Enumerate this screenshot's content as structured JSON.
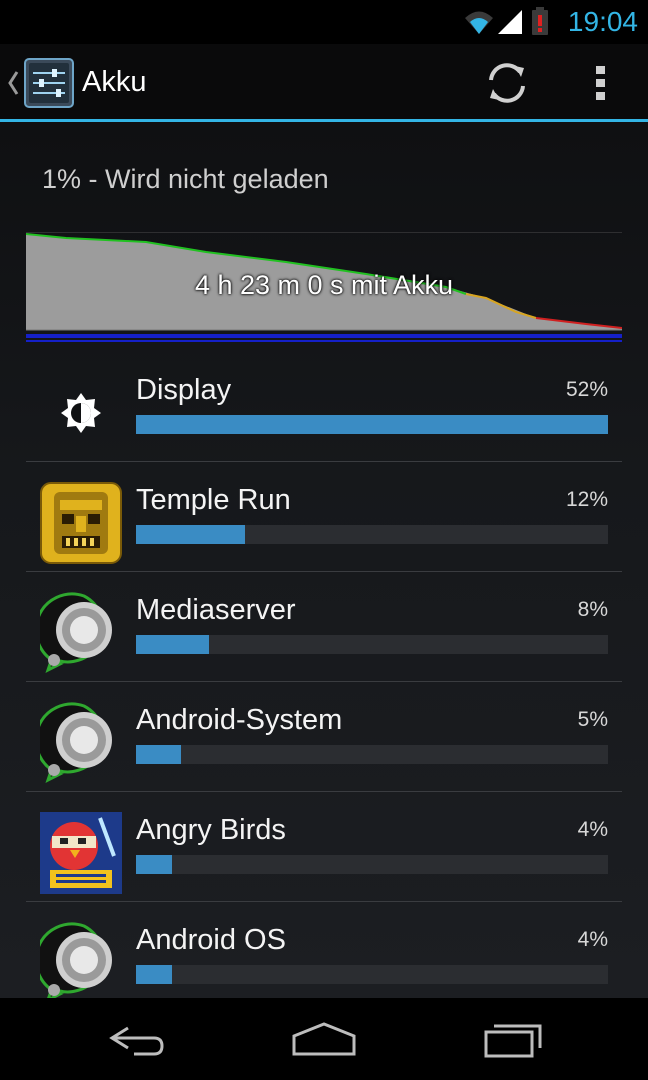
{
  "status_bar": {
    "time": "19:04",
    "icons": [
      "wifi-icon",
      "signal-icon",
      "battery-low-icon"
    ],
    "accent_color": "#33b5e5"
  },
  "action_bar": {
    "title": "Akku",
    "icons": [
      "up-caret-icon",
      "settings-app-icon",
      "refresh-icon",
      "overflow-menu-icon"
    ]
  },
  "battery": {
    "status": "1% - Wird nicht geladen",
    "graph_label": "4 h 23 m 0 s mit Akku"
  },
  "apps": [
    {
      "name": "Display",
      "percent": "52%",
      "value": 52,
      "icon": "display-brightness-icon"
    },
    {
      "name": "Temple Run",
      "percent": "12%",
      "value": 12,
      "icon": "temple-run-icon"
    },
    {
      "name": "Mediaserver",
      "percent": "8%",
      "value": 8,
      "icon": "android-system-icon"
    },
    {
      "name": "Android-System",
      "percent": "5%",
      "value": 5,
      "icon": "android-system-icon"
    },
    {
      "name": "Angry Birds",
      "percent": "4%",
      "value": 4,
      "icon": "angry-birds-star-wars-icon"
    },
    {
      "name": "Android OS",
      "percent": "4%",
      "value": 4,
      "icon": "android-system-icon"
    }
  ],
  "nav_bar": {
    "icons": [
      "back-icon",
      "home-icon",
      "recent-apps-icon"
    ]
  }
}
